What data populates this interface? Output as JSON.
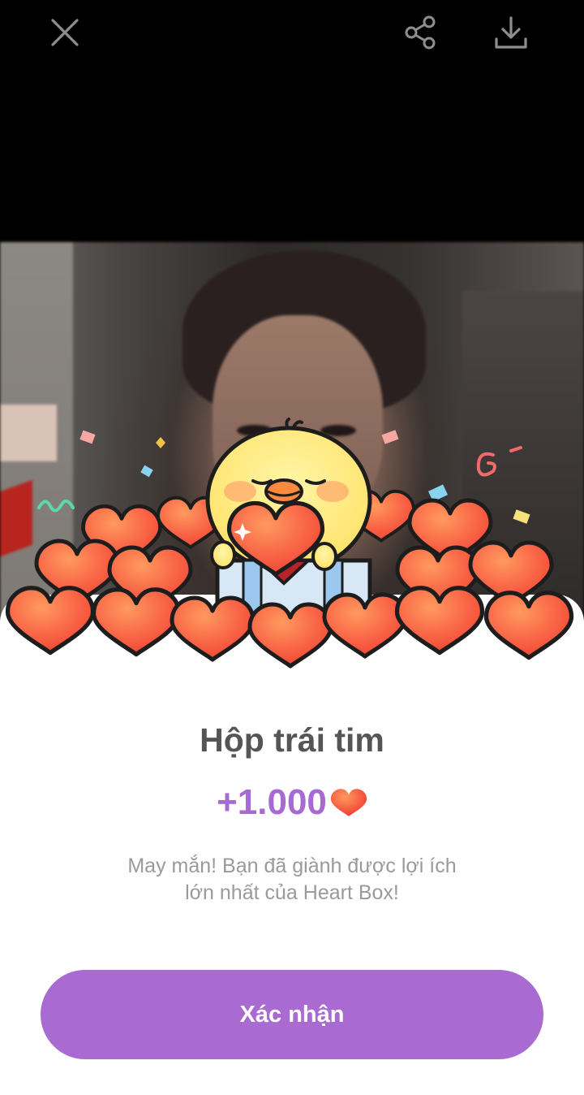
{
  "topbar": {
    "close_icon": "close-icon",
    "share_icon": "share-icon",
    "download_icon": "download-icon"
  },
  "dialog": {
    "title": "Hộp trái tim",
    "amount": "+1.000",
    "amount_icon": "heart-icon",
    "description_line1": "May mắn! Bạn đã giành được lợi ích",
    "description_line2": "lớn nhất của Heart Box!",
    "confirm_label": "Xác nhận"
  },
  "colors": {
    "accent": "#a96ad1",
    "amount": "#a66bd2",
    "title": "#555555",
    "heart": "#f4543c"
  }
}
